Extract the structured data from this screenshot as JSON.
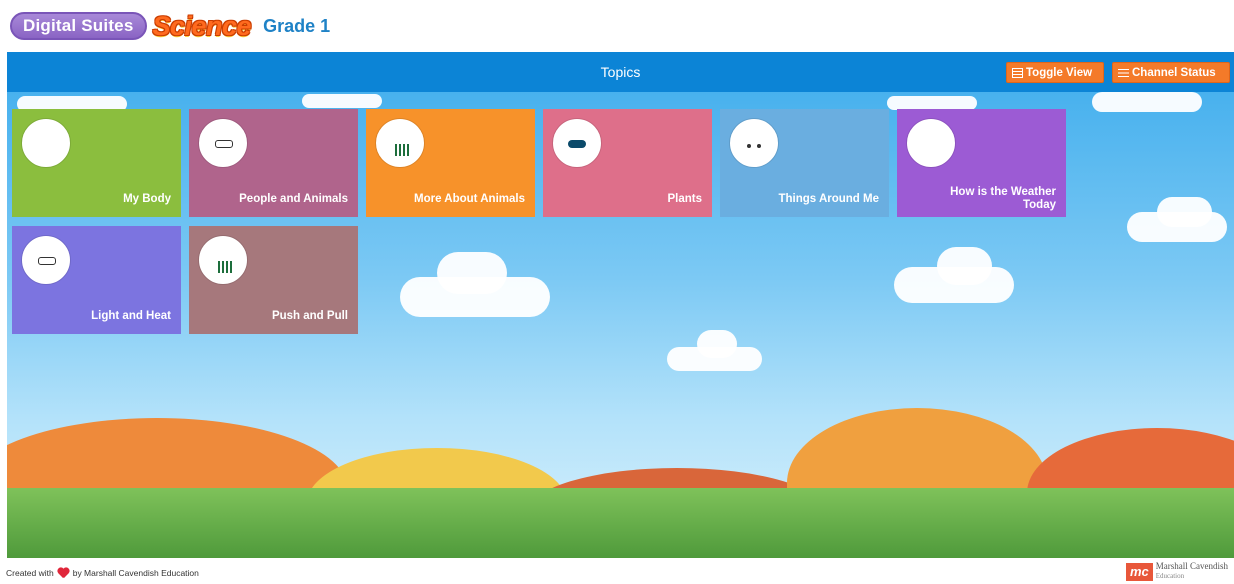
{
  "header": {
    "logo_primary": "Digital Suites",
    "logo_subject": "Science",
    "grade": "Grade 1"
  },
  "topbar": {
    "title": "Topics",
    "toggle_view_label": "Toggle View",
    "channel_status_label": "Channel Status"
  },
  "topics": [
    {
      "label": "My Body",
      "color": "#8bbe3e",
      "icon": "bee-mascot-icon"
    },
    {
      "label": "People and Animals",
      "color": "#b0648c",
      "icon": "yellow-robot-mascot-icon"
    },
    {
      "label": "More About Animals",
      "color": "#f7922a",
      "icon": "green-mascot-icon"
    },
    {
      "label": "Plants",
      "color": "#de6f8a",
      "icon": "blue-mascot-icon"
    },
    {
      "label": "Things Around Me",
      "color": "#6aaee0",
      "icon": "pink-mascot-icon"
    },
    {
      "label": "How is the Weather Today",
      "color": "#9c5bd4",
      "icon": "bee-mascot-icon"
    },
    {
      "label": "Light and Heat",
      "color": "#7c74e0",
      "icon": "yellow-robot-mascot-icon"
    },
    {
      "label": "Push and Pull",
      "color": "#a6787c",
      "icon": "green-mascot-icon"
    }
  ],
  "footer": {
    "created_with": "Created with",
    "by": "by Marshall Cavendish Education",
    "brand_mark": "mc",
    "brand_name": "Marshall Cavendish",
    "brand_sub": "Education"
  }
}
